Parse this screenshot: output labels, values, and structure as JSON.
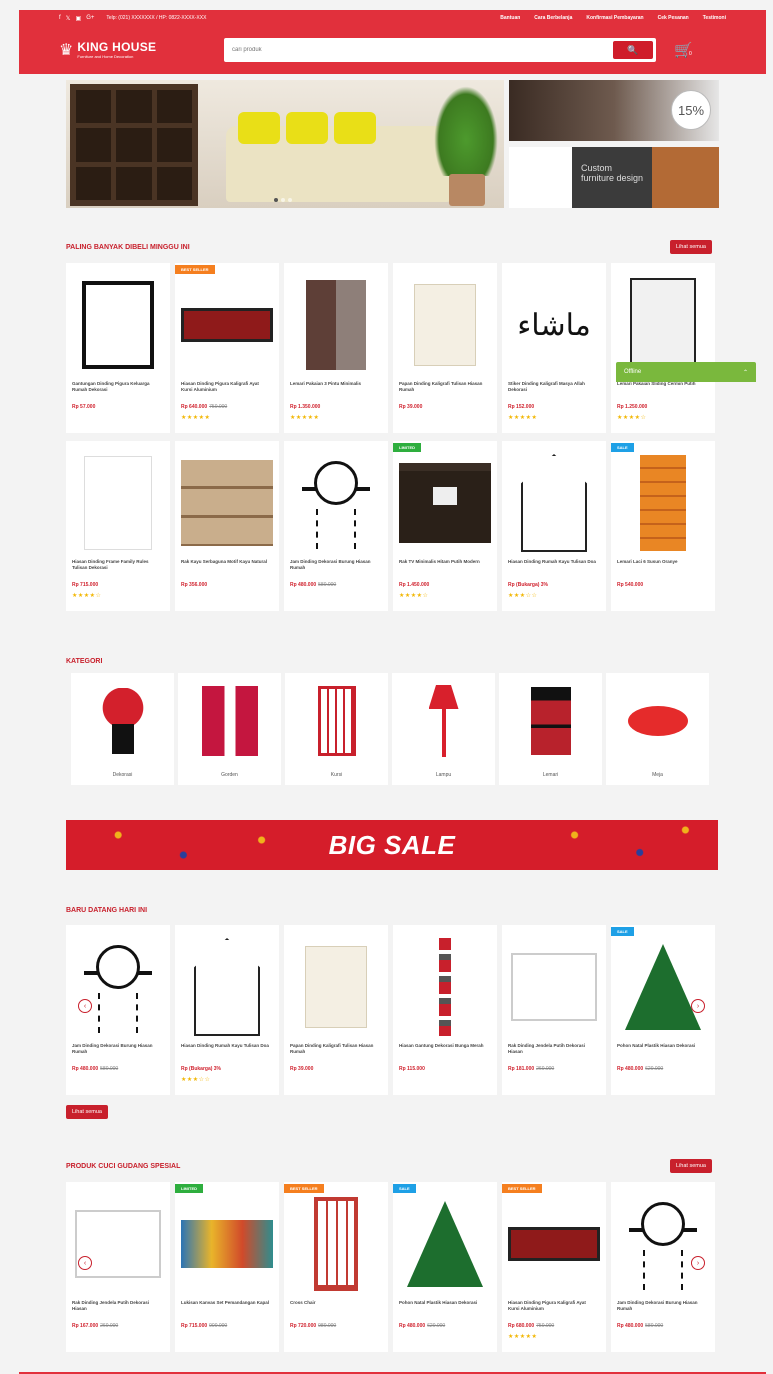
{
  "header": {
    "social_icons": [
      "facebook-icon",
      "twitter-icon",
      "instagram-icon",
      "google-plus-icon"
    ],
    "contact": "Telp: (021) XXXXXXX / HP: 0822-XXXX-XXX",
    "links": [
      "Bantuan",
      "Cara Berbelanja",
      "Konfirmasi Pembayaran",
      "Cek Pesanan",
      "Testimoni"
    ],
    "logo_name": "KING HOUSE",
    "logo_tagline": "Furniture and Home Decoration",
    "search_placeholder": "cari produk",
    "cart_count": "0",
    "accent_color": "#e1303c"
  },
  "hero": {
    "promo_top": "15%",
    "promo_bottom": "Custom furniture design"
  },
  "best_sellers": {
    "title": "PALING BANYAK DIBELI MINGGU INI",
    "see_all": "Lihat semua",
    "products": [
      {
        "name": "Gantungan Dinding Pigura Keluarga Rumah Dekorasi",
        "price": "Rp 57.000",
        "old_price": "",
        "stars": "",
        "badge": ""
      },
      {
        "name": "Hiasan Dinding Pigura Kaligrafi Ayat Kursi Aluminium",
        "price": "Rp 640.000",
        "old_price": "750.000",
        "stars": "★★★★★",
        "badge": "BEST SELLER"
      },
      {
        "name": "Lemari Pakaian 3 Pintu Minimalis",
        "price": "Rp 1.350.000",
        "old_price": "",
        "stars": "★★★★★",
        "badge": ""
      },
      {
        "name": "Papan Dinding Kaligrafi Tulisan Hiasan Rumah",
        "price": "Rp 39.000",
        "old_price": "",
        "stars": "",
        "badge": ""
      },
      {
        "name": "Stiker Dinding Kaligrafi Masya Allah Dekorasi",
        "price": "Rp 152.000",
        "old_price": "",
        "stars": "★★★★★",
        "badge": ""
      },
      {
        "name": "Lemari Pakaian Sliding Cermin Putih",
        "price": "Rp 1.250.000",
        "old_price": "",
        "stars": "★★★★☆",
        "badge": ""
      },
      {
        "name": "Hiasan Dinding Frame Family Rules Tulisan Dekorasi",
        "price": "Rp 715.000",
        "old_price": "",
        "stars": "★★★★☆",
        "badge": ""
      },
      {
        "name": "Rak Kayu Serbaguna Motif Kayu Natural",
        "price": "Rp 356.000",
        "old_price": "",
        "stars": "",
        "badge": ""
      },
      {
        "name": "Jam Dinding Dekorasi Burung Hiasan Rumah",
        "price": "Rp 480.000",
        "old_price": "580.000",
        "stars": "",
        "badge": ""
      },
      {
        "name": "Rak TV Minimalis Hitam Putih Modern",
        "price": "Rp 1.450.000",
        "old_price": "",
        "stars": "★★★★☆",
        "badge": "LIMITED"
      },
      {
        "name": "Hiasan Dinding Rumah Kayu Tulisan Doa",
        "price": "Rp (Bukarga) 3%",
        "old_price": "",
        "stars": "★★★☆☆",
        "badge": ""
      },
      {
        "name": "Lemari Laci 6 Susun Oranye",
        "price": "Rp 540.000",
        "old_price": "",
        "stars": "",
        "badge": "SALE"
      }
    ]
  },
  "offline_chat": {
    "label": "Offline",
    "icon": "chevron-up-icon"
  },
  "categories": {
    "title": "KATEGORI",
    "items": [
      "Dekorasi",
      "Gorden",
      "Kursi",
      "Lampu",
      "Lemari",
      "Meja"
    ]
  },
  "banner": {
    "text": "BIG SALE"
  },
  "new_arrivals": {
    "title": "BARU DATANG HARI INI",
    "see_all": "Lihat semua",
    "products": [
      {
        "name": "Jam Dinding Dekorasi Burung Hiasan Rumah",
        "price": "Rp 480.000",
        "old_price": "580.000",
        "stars": "",
        "badge": ""
      },
      {
        "name": "Hiasan Dinding Rumah Kayu Tulisan Doa",
        "price": "Rp (Bukarga) 3%",
        "old_price": "",
        "stars": "★★★☆☆",
        "badge": ""
      },
      {
        "name": "Papan Dinding Kaligrafi Tulisan Hiasan Rumah",
        "price": "Rp 39.000",
        "old_price": "",
        "stars": "",
        "badge": ""
      },
      {
        "name": "Hiasan Gantung Dekorasi Bunga Merah",
        "price": "Rp 115.000",
        "old_price": "",
        "stars": "",
        "badge": ""
      },
      {
        "name": "Rak Dinding Jendela Putih Dekorasi Hiasan",
        "price": "Rp 181.000",
        "old_price": "260.000",
        "stars": "",
        "badge": ""
      },
      {
        "name": "Pohon Natal Plastik Hiasan Dekorasi",
        "price": "Rp 480.000",
        "old_price": "620.000",
        "stars": "",
        "badge": "SALE"
      }
    ]
  },
  "clearance": {
    "title": "PRODUK CUCI GUDANG SPESIAL",
    "see_all": "Lihat semua",
    "products": [
      {
        "name": "Rak Dinding Jendela Putih Dekorasi Hiasan",
        "price": "Rp 167.000",
        "old_price": "260.000",
        "stars": "",
        "badge": ""
      },
      {
        "name": "Lukisan Kanvas Set Pemandangan Kapal",
        "price": "Rp 715.000",
        "old_price": "900.000",
        "stars": "",
        "badge": "LIMITED"
      },
      {
        "name": "Cross Chair",
        "price": "Rp 720.000",
        "old_price": "980.000",
        "stars": "",
        "badge": "BEST SELLER"
      },
      {
        "name": "Pohon Natal Plastik Hiasan Dekorasi",
        "price": "Rp 480.000",
        "old_price": "620.000",
        "stars": "",
        "badge": "SALE"
      },
      {
        "name": "Hiasan Dinding Pigura Kaligrafi Ayat Kursi Aluminium",
        "price": "Rp 680.000",
        "old_price": "750.000",
        "stars": "★★★★★",
        "badge": "BEST SELLER"
      },
      {
        "name": "Jam Dinding Dekorasi Burung Hiasan Rumah",
        "price": "Rp 480.000",
        "old_price": "580.000",
        "stars": "",
        "badge": ""
      }
    ]
  }
}
